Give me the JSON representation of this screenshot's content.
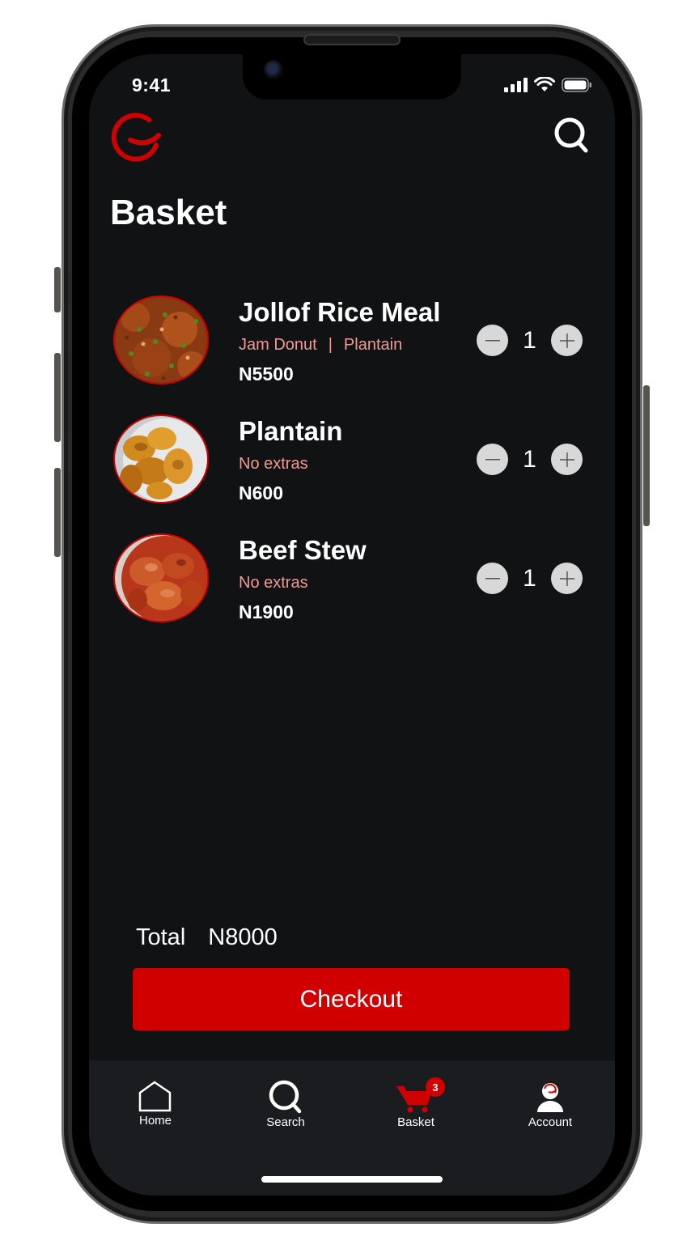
{
  "status": {
    "time": "9:41"
  },
  "header": {
    "logo_icon": "app-logo-icon",
    "search_icon": "search-icon"
  },
  "page": {
    "title": "Basket"
  },
  "basket": {
    "items": [
      {
        "name": "Jollof Rice Meal",
        "extras": [
          "Jam Donut",
          "Plantain"
        ],
        "extras_separator": "|",
        "price": "N5500",
        "quantity": "1"
      },
      {
        "name": "Plantain",
        "extras": [
          "No extras"
        ],
        "price": "N600",
        "quantity": "1"
      },
      {
        "name": "Beef Stew",
        "extras": [
          "No extras"
        ],
        "price": "N1900",
        "quantity": "1"
      }
    ]
  },
  "summary": {
    "total_label": "Total",
    "total_value": "N8000"
  },
  "checkout": {
    "label": "Checkout"
  },
  "nav": {
    "items": [
      {
        "label": "Home",
        "icon": "home-icon"
      },
      {
        "label": "Search",
        "icon": "search-icon"
      },
      {
        "label": "Basket",
        "icon": "cart-icon",
        "badge": "3"
      },
      {
        "label": "Account",
        "icon": "account-icon"
      }
    ]
  },
  "colors": {
    "accent": "#d10000",
    "background": "#111214",
    "nav_background": "#1a1c1f",
    "extras_text": "#f09a92"
  }
}
